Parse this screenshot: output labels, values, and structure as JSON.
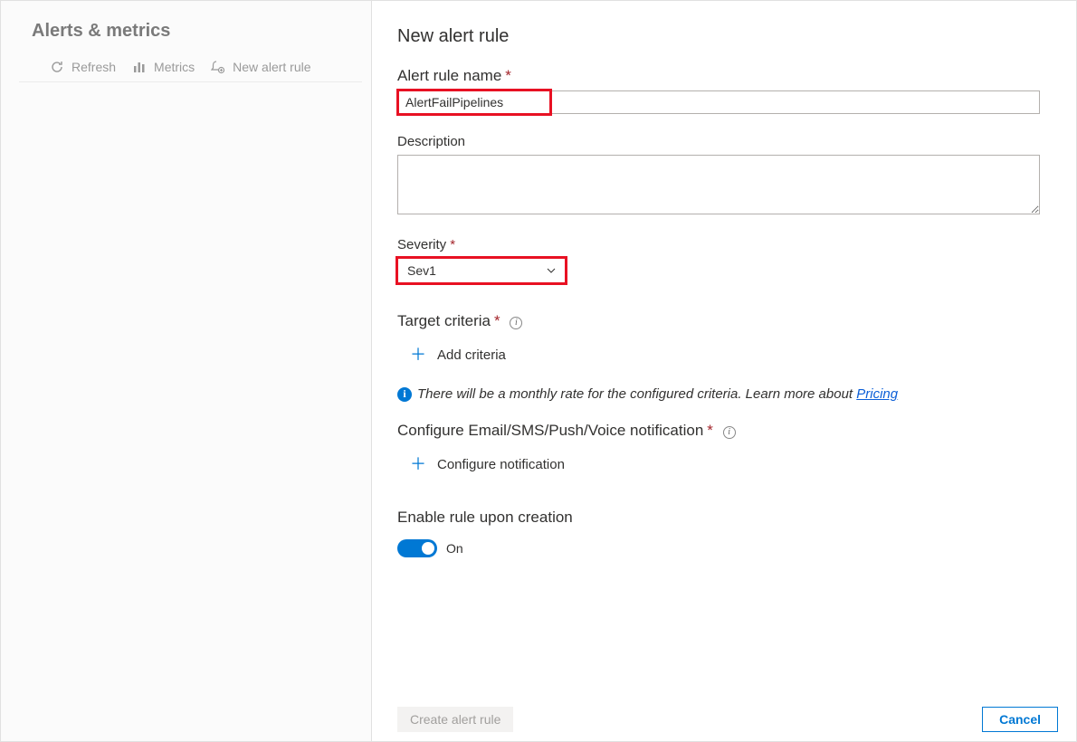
{
  "sidebar": {
    "title": "Alerts & metrics",
    "toolbar": {
      "refresh": "Refresh",
      "metrics": "Metrics",
      "new_rule": "New alert rule"
    }
  },
  "page": {
    "title": "New alert rule"
  },
  "form": {
    "name_label": "Alert rule name",
    "name_value": "AlertFailPipelines",
    "desc_label": "Description",
    "desc_value": "",
    "severity_label": "Severity",
    "severity_value": "Sev1",
    "target_label": "Target criteria",
    "add_criteria": "Add criteria",
    "info_text": "There will be a monthly rate for the configured criteria. Learn more about ",
    "info_link": "Pricing",
    "notif_label": "Configure Email/SMS/Push/Voice notification",
    "configure_notif": "Configure notification",
    "enable_label": "Enable rule upon creation",
    "toggle_state": "On"
  },
  "footer": {
    "create": "Create alert rule",
    "cancel": "Cancel"
  }
}
